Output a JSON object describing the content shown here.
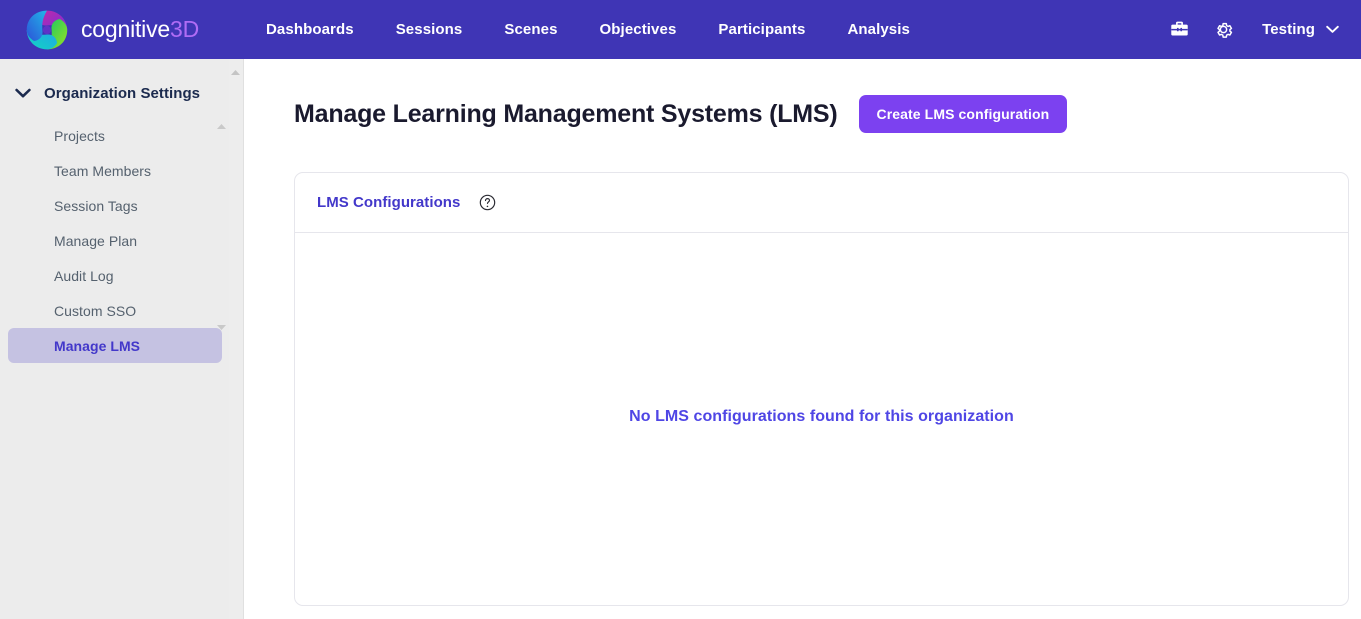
{
  "topnav": {
    "brand": {
      "word1": "cognitive",
      "word2": "3D",
      "logo_icon": "cognitive3d-swirl-logo"
    },
    "links": [
      {
        "label": "Dashboards"
      },
      {
        "label": "Sessions"
      },
      {
        "label": "Scenes"
      },
      {
        "label": "Objectives"
      },
      {
        "label": "Participants"
      },
      {
        "label": "Analysis"
      }
    ],
    "icons": [
      {
        "name": "toolbox-icon"
      },
      {
        "name": "gear-icon"
      }
    ],
    "user_menu": {
      "label": "Testing",
      "caret_icon": "chevron-down-icon"
    },
    "background_color": "#3F35B5",
    "brand_accent_color": "#B06CF5"
  },
  "sidebar": {
    "header": {
      "label": "Organization Settings",
      "chevron_icon": "chevron-down-icon"
    },
    "items": [
      {
        "label": "Projects",
        "active": false
      },
      {
        "label": "Team Members",
        "active": false
      },
      {
        "label": "Session Tags",
        "active": false
      },
      {
        "label": "Manage Plan",
        "active": false
      },
      {
        "label": "Audit Log",
        "active": false
      },
      {
        "label": "Custom SSO",
        "active": false
      },
      {
        "label": "Manage LMS",
        "active": true
      }
    ],
    "active_bg_color": "#C5C2E2",
    "active_text_color": "#4338CA",
    "background_color": "#ECECEC"
  },
  "main": {
    "page_title": "Manage Learning Management Systems (LMS)",
    "create_button": {
      "label": "Create LMS configuration",
      "color": "#7C41F0"
    },
    "card": {
      "title": "LMS Configurations",
      "title_color": "#4338CA",
      "help_icon": "question-mark-circle-icon",
      "empty_message": "No LMS configurations found for this organization",
      "empty_message_color": "#4F46E5"
    }
  }
}
